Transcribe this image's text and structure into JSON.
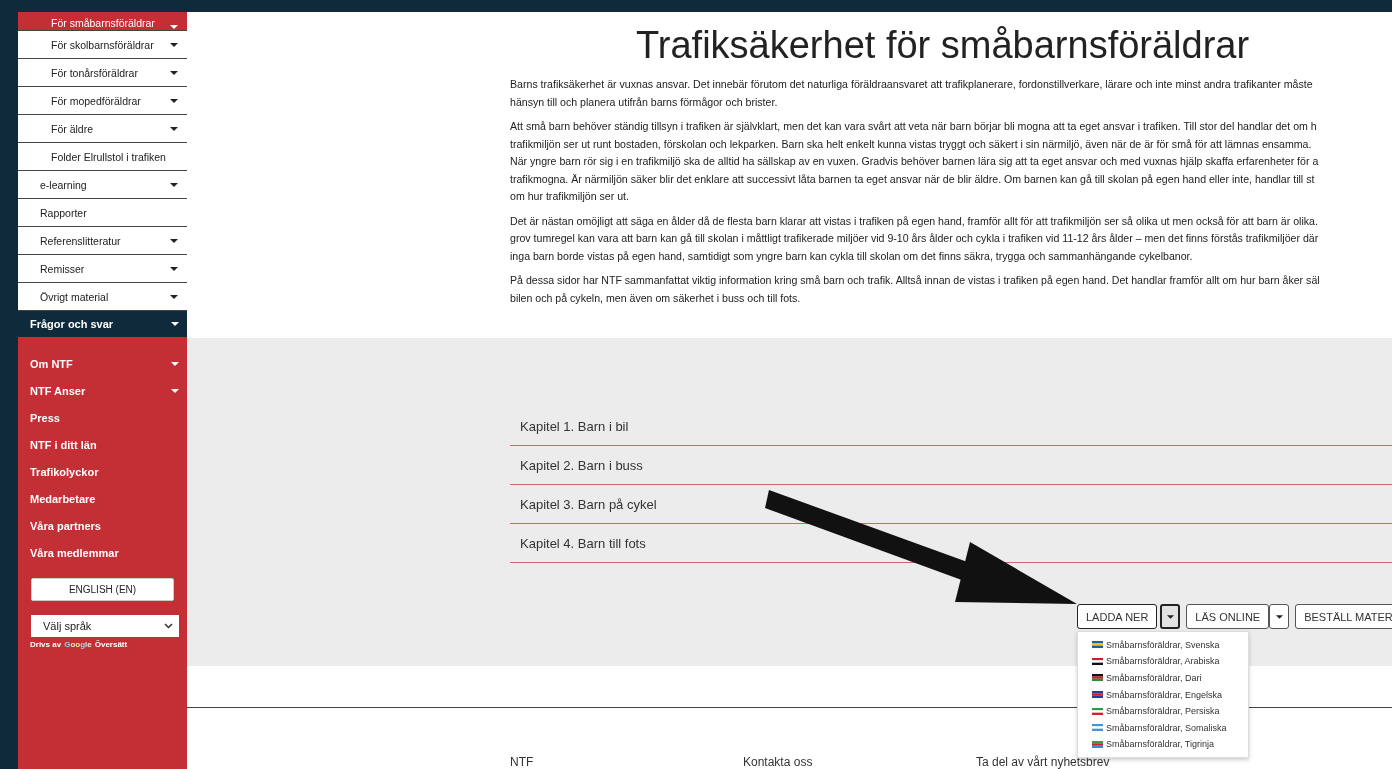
{
  "sidebar": {
    "subitems": [
      {
        "label": "För småbarnsföräldrar",
        "expandable": true,
        "selected": true
      },
      {
        "label": "För skolbarnsföräldrar",
        "expandable": true,
        "selected": false
      },
      {
        "label": "För tonårsföräldrar",
        "expandable": true,
        "selected": false
      },
      {
        "label": "För mopedföräldrar",
        "expandable": true,
        "selected": false
      },
      {
        "label": "För äldre",
        "expandable": true,
        "selected": false
      },
      {
        "label": "Folder Elrullstol i trafiken",
        "expandable": false,
        "selected": false
      }
    ],
    "items": [
      {
        "label": "e-learning",
        "expandable": true
      },
      {
        "label": "Rapporter",
        "expandable": false
      },
      {
        "label": "Referenslitteratur",
        "expandable": true
      },
      {
        "label": "Remisser",
        "expandable": true
      },
      {
        "label": "Övrigt material",
        "expandable": true
      }
    ],
    "active_section": {
      "label": "Frågor och svar",
      "expandable": true
    },
    "main_links": [
      {
        "label": "Om NTF",
        "expandable": true
      },
      {
        "label": "NTF Anser",
        "expandable": true
      },
      {
        "label": "Press",
        "expandable": false
      },
      {
        "label": "NTF i ditt län",
        "expandable": false
      },
      {
        "label": "Trafikolyckor",
        "expandable": false
      },
      {
        "label": "Medarbetare",
        "expandable": false
      },
      {
        "label": "Våra partners",
        "expandable": false
      },
      {
        "label": "Våra medlemmar",
        "expandable": false
      }
    ],
    "english_button": "ENGLISH (EN)",
    "language_select": "Välj språk",
    "powered_by": "Drivs av",
    "google": "Google",
    "translate": "Översätt"
  },
  "title": "Trafiksäkerhet för småbarnsföräldrar",
  "paragraphs": [
    [
      "Barns trafiksäkerhet är vuxnas ansvar. Det innebär förutom det naturliga föräldraansvaret att trafikplanerare, fordonstillverkare, lärare och inte minst andra trafikanter måste",
      "hänsyn till och planera utifrån barns förmågor och brister."
    ],
    [
      "Att små barn behöver ständig tillsyn i trafiken är självklart, men det kan vara svårt att veta när barn börjar bli mogna att ta eget ansvar i trafiken. Till stor del handlar det om h",
      "trafikmiljön ser ut runt bostaden, förskolan och lekparken. Barn ska helt enkelt kunna vistas tryggt och säkert i sin närmiljö, även när de är för små för att lämnas ensamma.",
      "När yngre barn rör sig i en trafikmiljö ska de alltid ha sällskap av en vuxen. Gradvis behöver barnen lära sig att ta eget ansvar och med vuxnas hjälp skaffa erfarenheter för a",
      "trafikmogna. Är närmiljön säker blir det enklare att successivt låta barnen ta eget ansvar när de blir äldre. Om barnen kan gå till skolan på egen hand eller inte, handlar till st",
      "om hur trafikmiljön ser ut."
    ],
    [
      "Det är nästan omöjligt att säga en ålder då de flesta barn klarar att vistas i trafiken på egen hand, framför allt för att trafikmiljön ser så olika ut men också för att barn är olika.",
      "grov tumregel kan vara att barn kan gå till skolan i måttligt trafikerade miljöer vid 9-10 års ålder och cykla i trafiken vid 11-12 års ålder – men det finns förstås trafikmiljöer där",
      "inga barn borde vistas på egen hand, samtidigt som yngre barn kan cykla till skolan om det finns säkra, trygga och sammanhängande cykelbanor."
    ],
    [
      "På dessa sidor har NTF sammanfattat viktig information kring små barn och trafik. Alltså innan de vistas i trafiken på egen hand. Det handlar framför allt om hur barn åker säl",
      "bilen och på cykeln, men även om säkerhet i buss och till fots."
    ]
  ],
  "chapters": [
    "Kapitel 1. Barn i bil",
    "Kapitel 2. Barn i buss",
    "Kapitel 3. Barn på cykel",
    "Kapitel 4. Barn till fots"
  ],
  "buttons": [
    {
      "label": "LADDA NER",
      "kind": "split",
      "expanded": true
    },
    {
      "label": "LÄS ONLINE",
      "kind": "split",
      "expanded": false
    },
    {
      "label": "BESTÄLL MATER",
      "kind": "plain"
    }
  ],
  "download_menu": [
    "Småbarnsföräldrar, Svenska",
    "Småbarnsföräldrar, Arabiska",
    "Småbarnsföräldrar, Dari",
    "Småbarnsföräldrar, Engelska",
    "Småbarnsföräldrar, Persiska",
    "Småbarnsföräldrar, Somaliska",
    "Småbarnsföräldrar, Tigrinja"
  ],
  "footer": [
    "NTF",
    "Kontakta oss",
    "Ta del av vårt nyhetsbrev"
  ]
}
